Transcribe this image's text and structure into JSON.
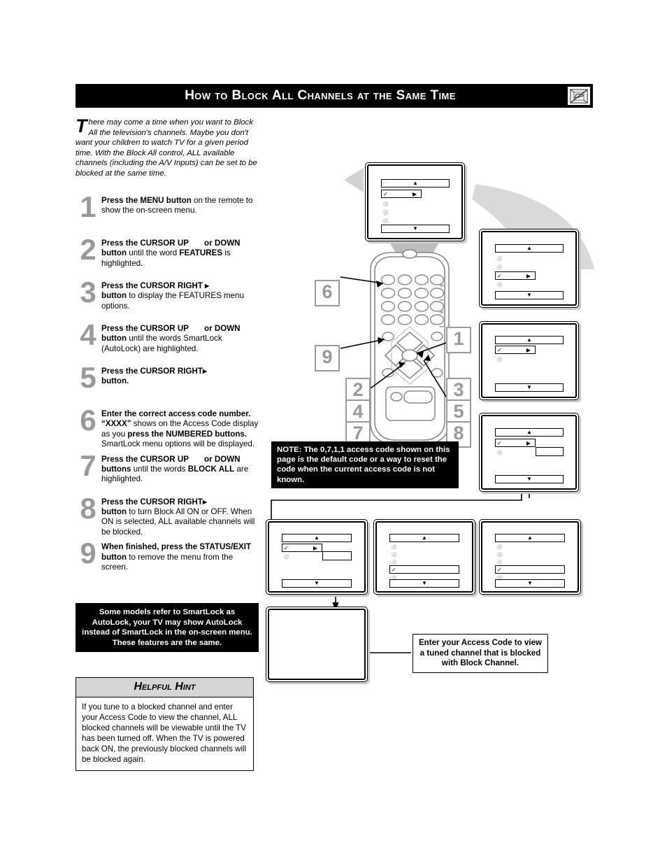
{
  "header": {
    "title": "How to Block All Channels at the Same Time",
    "icon": "tv-hand-icon"
  },
  "intro": {
    "dropcap": "T",
    "text": "here may come a time when you want to Block All the television's channels. Maybe you don't want your children to watch TV for a given period time. With the Block All control, ALL available channels (including the A/V Inputs) can be set to be blocked at the same time."
  },
  "steps": [
    {
      "number": "1",
      "html": "<b>Press the MENU button</b> on the remote to show the on-screen menu."
    },
    {
      "number": "2",
      "html": "<b>Press the CURSOR UP</b><span class='gap'></span><b>or DOWN</b><span class='gap'></span><b>button</b> until the word <b>FEATURES</b> is highlighted."
    },
    {
      "number": "3",
      "html": "<b>Press the CURSOR RIGHT &#9656;</b><br><b>button</b> to display the FEATURES menu options."
    },
    {
      "number": "4",
      "html": "<b>Press the CURSOR UP</b><span class='gap'></span><b>or DOWN</b><span class='gap'></span><b>button</b> until the words SmartLock (AutoLock) are highlighted."
    },
    {
      "number": "5",
      "html": "<b>Press the CURSOR RIGHT&#9656;<br>button.</b>"
    },
    {
      "number": "6",
      "html": "<b>Enter the correct access code number. &ldquo;XXXX&rdquo;</b> shows on the Access Code display as you <b>press the NUMBERED buttons.</b> SmartLock menu options will be displayed."
    },
    {
      "number": "7",
      "html": "<b>Press the CURSOR UP</b><span class='gap'></span><b>or DOWN</b><span class='gap'></span><b>buttons</b> until the words <b>BLOCK ALL</b> are highlighted."
    },
    {
      "number": "8",
      "html": "<b>Press the CURSOR RIGHT&#9656;<br>button</b> to turn Block All ON or OFF. When ON is selected, ALL available channels will be blocked."
    },
    {
      "number": "9",
      "html": "<b>When finished, press the STATUS/EXIT button</b> to remove the menu from the screen."
    }
  ],
  "smartlock_note": "Some models refer to SmartLock as AutoLock, your TV may show AutoLock instead of SmartLock in the on-screen menu. These features are the same.",
  "hint": {
    "heading": "Helpful Hint",
    "body": "If you tune to a blocked channel and enter your Access Code to view the channel, ALL blocked channels will be viewable until the TV has been turned off. When the TV is powered back ON, the previously blocked channels will be blocked again."
  },
  "note_box": {
    "text": "NOTE: The 0,7,1,1 access code shown on this page is the default code or a way to reset the code when the current access code is not known."
  },
  "access_code_callout": {
    "text": "Enter your Access Code to view a tuned channel that is blocked with Block Channel."
  },
  "remote": {
    "callouts": [
      {
        "id": "callout-6",
        "label": "6"
      },
      {
        "id": "callout-9",
        "label": "9"
      },
      {
        "id": "callout-1",
        "label": "1"
      },
      {
        "id": "callout-2",
        "label": "2"
      },
      {
        "id": "callout-4",
        "label": "4"
      },
      {
        "id": "callout-7",
        "label": "7"
      },
      {
        "id": "callout-3",
        "label": "3"
      },
      {
        "id": "callout-5",
        "label": "5"
      },
      {
        "id": "callout-8",
        "label": "8"
      }
    ]
  },
  "tv_screens": [
    {
      "id": "tv-main-menu",
      "highlight_row": 1,
      "rows": 5,
      "submenu": false
    },
    {
      "id": "tv-features-menu",
      "highlight_row": 3,
      "rows": 5,
      "submenu": false
    },
    {
      "id": "tv-access-code",
      "highlight_row": 1,
      "rows": 2,
      "submenu": false
    },
    {
      "id": "tv-smartlock-menu",
      "highlight_row": 1,
      "rows": 3,
      "submenu": true
    },
    {
      "id": "tv-block-all-1",
      "highlight_row": 1,
      "rows": 3,
      "submenu": true
    },
    {
      "id": "tv-block-all-2",
      "highlight_row": 4,
      "rows": 7,
      "submenu": false
    },
    {
      "id": "tv-block-all-3",
      "highlight_row": 4,
      "rows": 7,
      "submenu": false
    },
    {
      "id": "tv-blocked-screen",
      "highlight_row": 0,
      "rows": 0,
      "submenu": false
    }
  ],
  "colors": {
    "header_bar": "#000000",
    "step_number": "#9a9a9a",
    "hint_heading_bg": "#d5d5d5",
    "swoosh": "#cccccc"
  }
}
